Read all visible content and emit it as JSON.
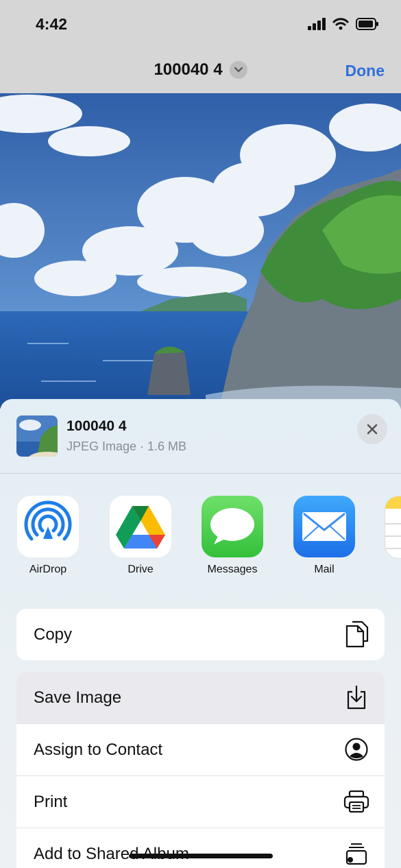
{
  "status": {
    "time": "4:42"
  },
  "navbar": {
    "title": "100040 4",
    "done_label": "Done"
  },
  "file": {
    "name": "100040 4",
    "meta": "JPEG Image · 1.6 MB"
  },
  "apps": [
    {
      "label": "AirDrop",
      "icon": "airdrop-icon"
    },
    {
      "label": "Drive",
      "icon": "google-drive-icon"
    },
    {
      "label": "Messages",
      "icon": "messages-icon"
    },
    {
      "label": "Mail",
      "icon": "mail-icon"
    },
    {
      "label": "",
      "icon": "notes-icon"
    }
  ],
  "actions": {
    "copy": {
      "label": "Copy",
      "icon": "copy-icon"
    },
    "save_image": {
      "label": "Save Image",
      "icon": "save-icon"
    },
    "assign_contact": {
      "label": "Assign to Contact",
      "icon": "contact-icon"
    },
    "print": {
      "label": "Print",
      "icon": "printer-icon"
    },
    "shared_album": {
      "label": "Add to Shared Album",
      "icon": "shared-album-icon"
    }
  },
  "colors": {
    "accent": "#2f6fdd",
    "highlight_row": "#e9e9ee"
  }
}
